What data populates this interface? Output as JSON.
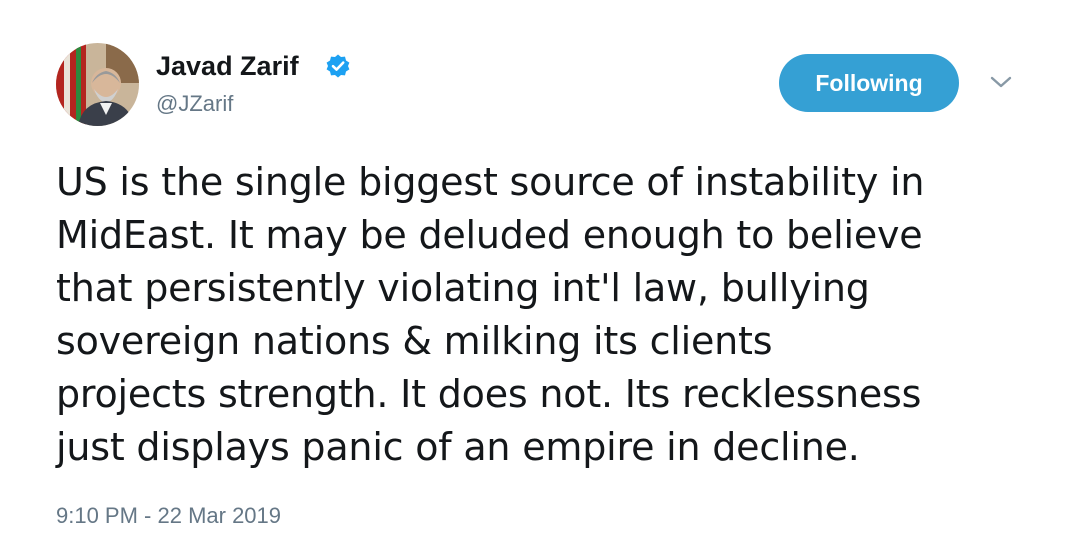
{
  "author": {
    "display_name": "Javad Zarif",
    "handle": "@JZarif",
    "verified": true,
    "avatar_icon": "profile-photo"
  },
  "actions": {
    "follow_label": "Following",
    "menu_icon": "chevron-down-icon"
  },
  "tweet": {
    "lines": [
      "US is the single biggest source of instability in",
      "MidEast. It may be deluded enough to believe",
      "that persistently violating int'l law, bullying",
      "sovereign nations & milking its clients",
      "projects strength. It does not. Its recklessness",
      "just displays panic of an empire in decline."
    ],
    "timestamp": "9:10 PM - 22 Mar 2019"
  },
  "colors": {
    "follow_button": "#35a0d4",
    "verified_badge": "#1da1f2",
    "secondary_text": "#657786",
    "primary_text": "#14171a"
  }
}
